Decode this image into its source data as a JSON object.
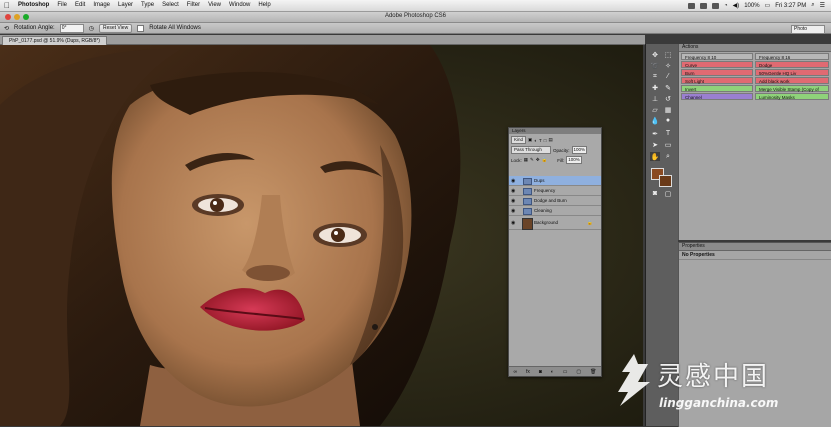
{
  "menubar": {
    "app": "Photoshop",
    "items": [
      "File",
      "Edit",
      "Image",
      "Layer",
      "Type",
      "Select",
      "Filter",
      "View",
      "Window",
      "Help"
    ],
    "battery": "100%",
    "clock": "Fri 3:27 PM"
  },
  "window": {
    "title": "Adobe Photoshop CS6"
  },
  "options_bar": {
    "rotation_label": "Rotation Angle:",
    "rotation_value": "0°",
    "reset_view": "Reset View",
    "rotate_all": "Rotate All Windows",
    "workspace": "Photo"
  },
  "document": {
    "tab": "PhP_0177.psd @ 51.9% (Dups, RGB/8*)"
  },
  "actions": {
    "title": "Actions",
    "rows": [
      {
        "left": "Frequency 8 10",
        "right": "Frequency 8 16",
        "color": "#b7b7b7"
      },
      {
        "left": "Curve",
        "right": "Dodge",
        "color": "#e06a72"
      },
      {
        "left": "Burn",
        "right": "50%Gentle HQ Liv",
        "color": "#e06a72"
      },
      {
        "left": "Soft Light",
        "right": "Add black work",
        "color": "#e06a72"
      },
      {
        "left": "Invert",
        "right": "Merge Visible Stamp (Copy of",
        "color": "#8fd27a"
      },
      {
        "left": "Channel",
        "right": "Luminosity Masks",
        "color": "#9a7fd0"
      }
    ],
    "right_colors": [
      "#b7b7b7",
      "#e06a72",
      "#e06a72",
      "#e06a72",
      "#8fd27a",
      "#8fd27a"
    ]
  },
  "properties": {
    "title": "Properties",
    "empty": "No Properties"
  },
  "layers": {
    "title": "Layers",
    "kind": "Kind",
    "blend": "Pass Through",
    "opacity_label": "Opacity:",
    "opacity": "100%",
    "lock_label": "Lock:",
    "fill_label": "Fill:",
    "fill": "100%",
    "rows": [
      {
        "name": "Dups",
        "type": "group",
        "selected": true
      },
      {
        "name": "Frequency",
        "type": "group",
        "selected": false
      },
      {
        "name": "Dodge and Burn",
        "type": "group",
        "selected": false
      },
      {
        "name": "Cleaning",
        "type": "group",
        "selected": false
      },
      {
        "name": "Background",
        "type": "image",
        "selected": false
      }
    ]
  },
  "watermark": {
    "brand": "灵感中国",
    "url": "lingganchina.com"
  },
  "colors": {
    "foreground": "#8a4a22",
    "background": "#6a3a18"
  }
}
